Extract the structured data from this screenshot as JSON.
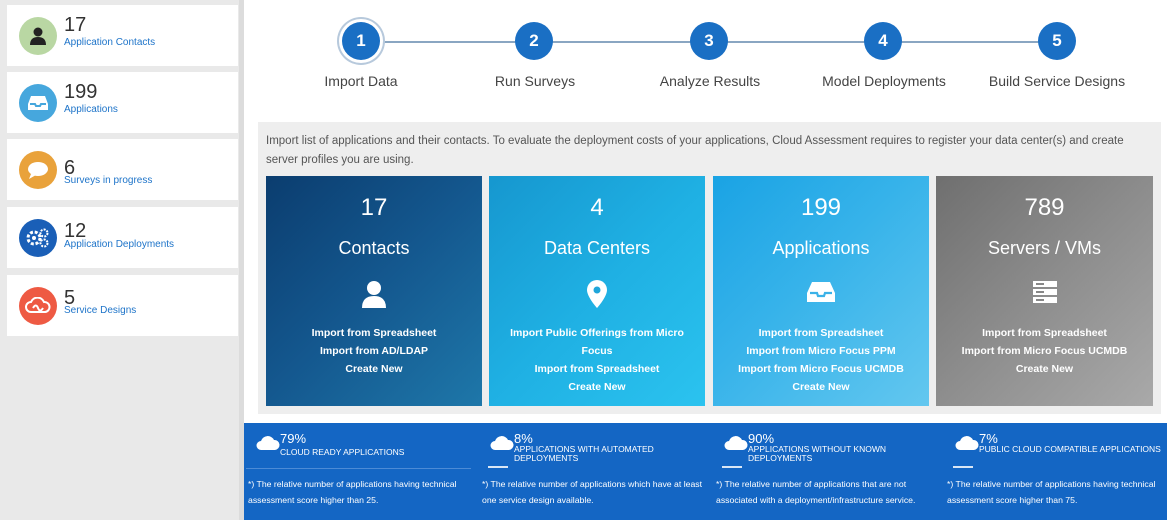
{
  "sidebar": {
    "cards": [
      {
        "count": "17",
        "label": "Application Contacts",
        "icon": "contacts-icon",
        "color": "#b9d7a3"
      },
      {
        "count": "199",
        "label": "Applications",
        "icon": "inbox-icon",
        "color": "#46a7dd"
      },
      {
        "count": "6",
        "label": "Surveys in progress",
        "icon": "chat-bubble-icon",
        "color": "#e9a23b"
      },
      {
        "count": "12",
        "label": "Application Deployments",
        "icon": "gears-icon",
        "color": "#1a5fb7"
      },
      {
        "count": "5",
        "label": "Service Designs",
        "icon": "cloud-link-icon",
        "color": "#ee5a43"
      }
    ]
  },
  "steps": [
    {
      "number": "1",
      "label": "Import Data",
      "active": true
    },
    {
      "number": "2",
      "label": "Run Surveys",
      "active": false
    },
    {
      "number": "3",
      "label": "Analyze Results",
      "active": false
    },
    {
      "number": "4",
      "label": "Model Deployments",
      "active": false
    },
    {
      "number": "5",
      "label": "Build Service Designs",
      "active": false
    }
  ],
  "description": "Import list of applications and their contacts. To evaluate the deployment costs of your applications, Cloud Assessment requires to register your data center(s) and create server profiles you are using.",
  "tiles": [
    {
      "count": "17",
      "title": "Contacts",
      "icon": "user-icon",
      "links": [
        "Import from Spreadsheet",
        "Import from AD/LDAP",
        "Create New"
      ]
    },
    {
      "count": "4",
      "title": "Data Centers",
      "icon": "location-pin-icon",
      "links": [
        "Import Public Offerings from Micro Focus",
        "Import from Spreadsheet",
        "Create New"
      ]
    },
    {
      "count": "199",
      "title": "Applications",
      "icon": "inbox-icon",
      "links": [
        "Import from Spreadsheet",
        "Import from Micro Focus PPM",
        "Import from Micro Focus UCMDB",
        "Create New"
      ]
    },
    {
      "count": "789",
      "title": "Servers / VMs",
      "icon": "server-icon",
      "links": [
        "Import from Spreadsheet",
        "Import from Micro Focus UCMDB",
        "Create New"
      ]
    }
  ],
  "metrics": [
    {
      "percent": "79%",
      "title": "CLOUD READY APPLICATIONS",
      "note": "*) The relative number of applications having technical assessment score higher than 25."
    },
    {
      "percent": "8%",
      "title": "APPLICATIONS WITH AUTOMATED DEPLOYMENTS",
      "note": "*) The relative number of applications which have at least one service design available."
    },
    {
      "percent": "90%",
      "title": "APPLICATIONS WITHOUT KNOWN DEPLOYMENTS",
      "note": "*) The relative number of applications that are not associated with a deployment/infrastructure service."
    },
    {
      "percent": "7%",
      "title": "PUBLIC CLOUD COMPATIBLE APPLICATIONS",
      "note": "*) The relative number of applications having technical assessment score higher than 75."
    }
  ]
}
